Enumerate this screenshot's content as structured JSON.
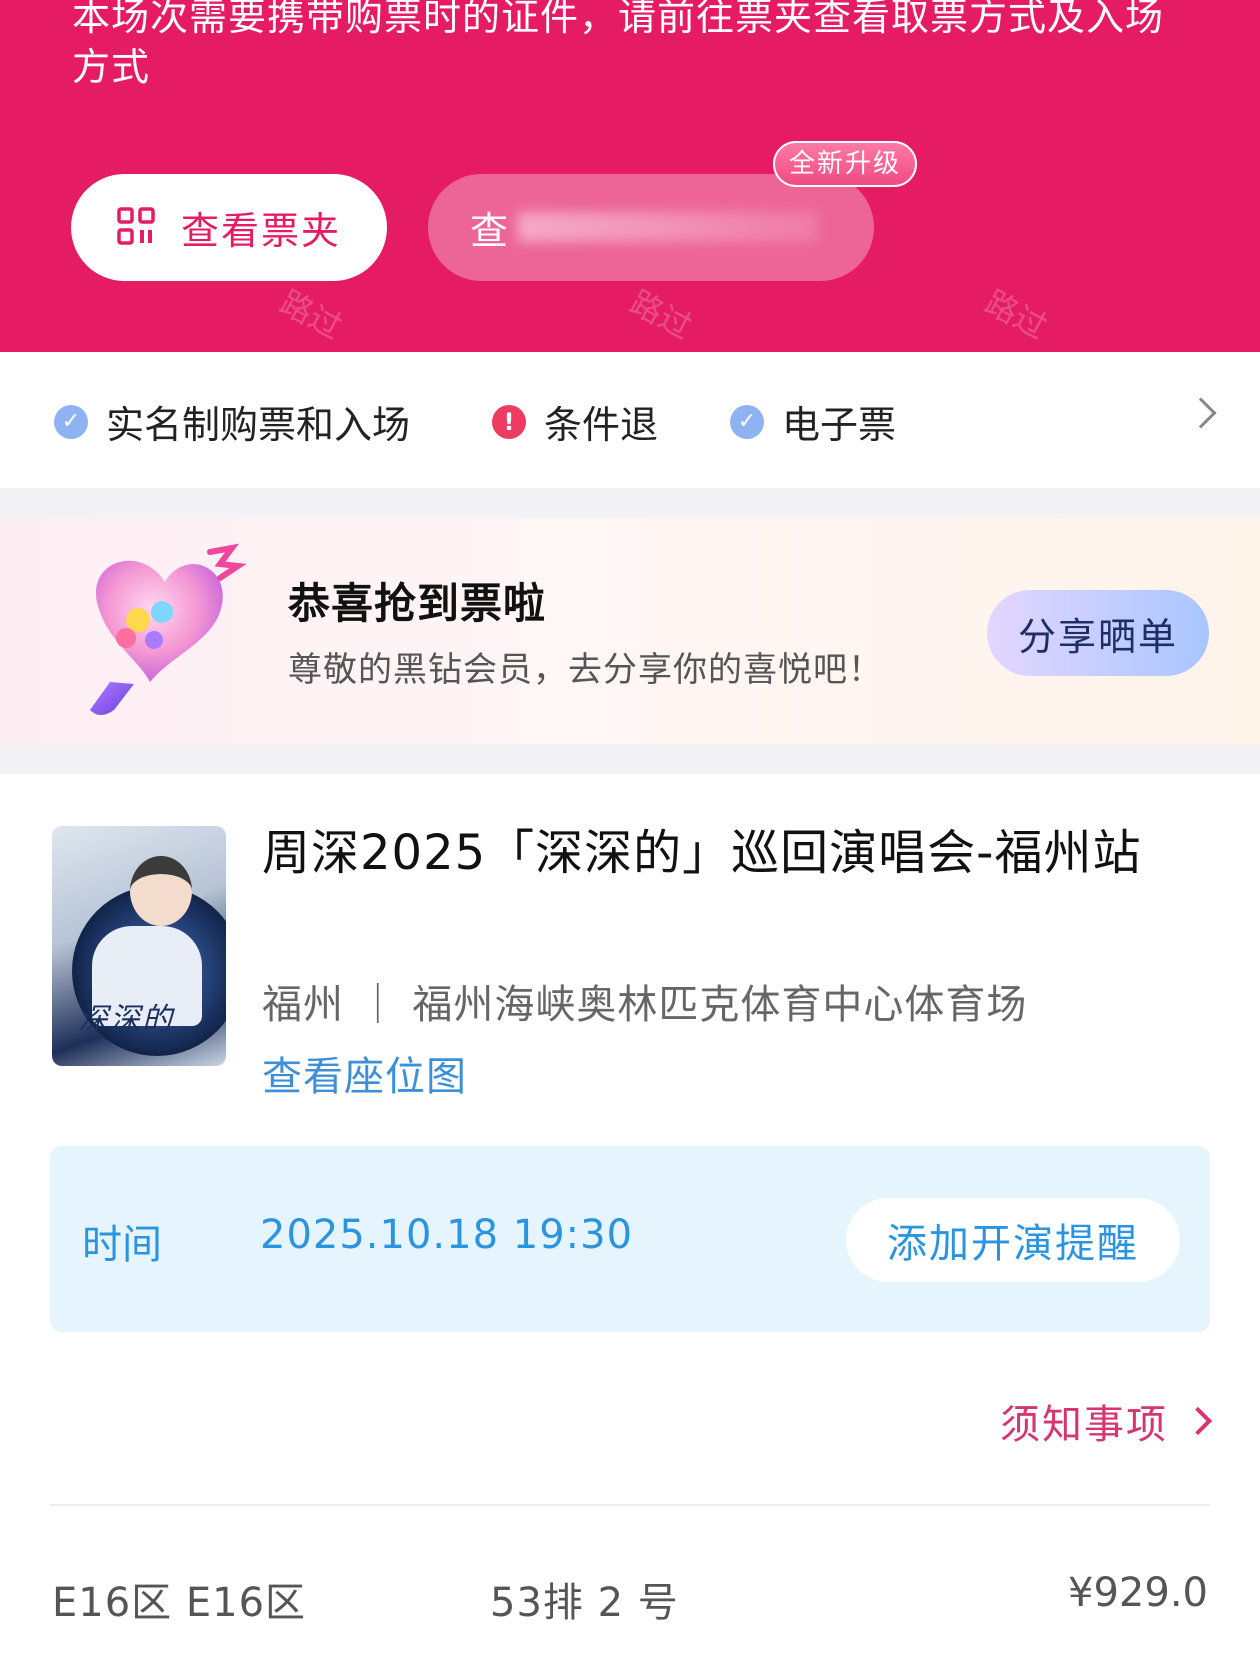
{
  "banner": {
    "note": "本场次需要携带购票时的证件，请前往票夹查看取票方式及入场方式",
    "wallet_button": "查看票夹",
    "secondary_button": "查",
    "new_badge": "全新升级",
    "watermark": "路过"
  },
  "features": [
    {
      "label": "实名制购票和入场",
      "icon": "check-icon"
    },
    {
      "label": "条件退",
      "icon": "warning-icon"
    },
    {
      "label": "电子票",
      "icon": "check-icon"
    }
  ],
  "congrats": {
    "title": "恭喜抢到票啦",
    "subtitle": "尊敬的黑钻会员，去分享你的喜悦吧！",
    "share_button": "分享晒单"
  },
  "event": {
    "title": "周深2025「深深的」巡回演唱会-福州站",
    "venue": "福州 ｜ 福州海峡奥林匹克体育中心体育场",
    "seat_map_link": "查看座位图",
    "poster_text": "深深的"
  },
  "time": {
    "label": "时间",
    "value": "2025.10.18 19:30",
    "remind_button": "添加开演提醒"
  },
  "notice": {
    "label": "须知事项"
  },
  "ticket": {
    "zone": "E16区 E16区",
    "seat": "53排 2  号",
    "price": "¥929.0"
  },
  "colors": {
    "brand_pink": "#e51c63",
    "link_blue": "#3d8fd6",
    "time_blue": "#2a94e0"
  }
}
